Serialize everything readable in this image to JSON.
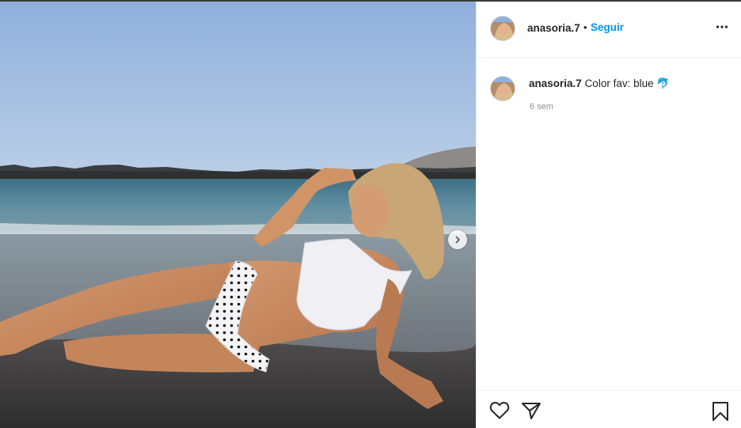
{
  "post": {
    "username": "anasoria.7",
    "separator": "•",
    "follow_label": "Seguir",
    "caption": {
      "username": "anasoria.7",
      "text": "Color fav: blue",
      "emoji": "🐬",
      "time": "6 sem"
    }
  },
  "icons": {
    "more": "more-options-icon",
    "next": "chevron-right-icon",
    "like": "heart-icon",
    "share": "paper-plane-icon",
    "save": "bookmark-icon"
  },
  "colors": {
    "accent": "#0095f6",
    "text": "#262626",
    "muted": "#8e8e8e",
    "border": "#efefef"
  }
}
